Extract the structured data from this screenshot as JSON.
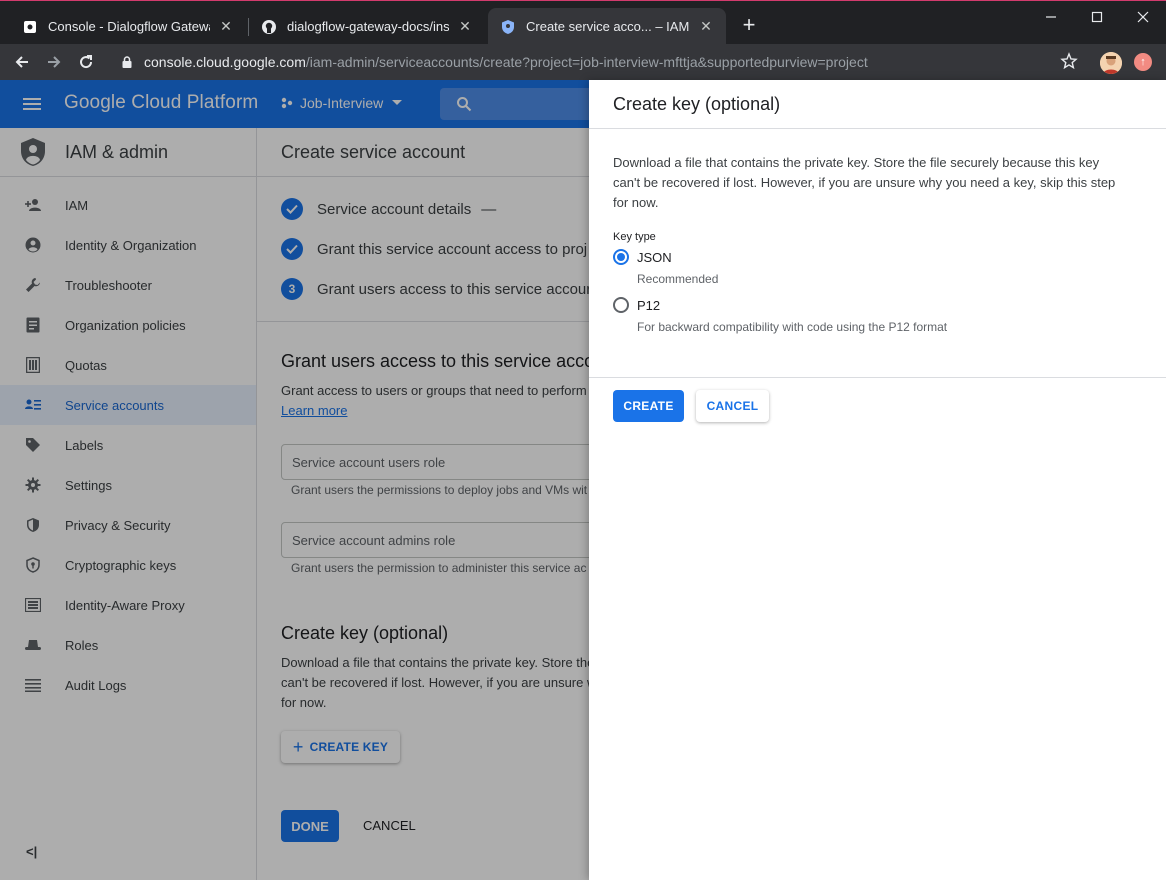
{
  "browser": {
    "tabs": [
      {
        "title": "Console - Dialogflow Gateway",
        "active": false
      },
      {
        "title": "dialogflow-gateway-docs/installa",
        "active": false
      },
      {
        "title": "Create service acco... – IAM & ad",
        "active": true
      }
    ],
    "url_host": "console.cloud.google.com",
    "url_path": "/iam-admin/serviceaccounts/create?project=job-interview-mfttja&supportedpurview=project"
  },
  "header": {
    "brand": "Google Cloud Platform",
    "project": "Job-Interview"
  },
  "sidenav": {
    "title": "IAM & admin",
    "items": [
      {
        "label": "IAM",
        "icon": "person-add-icon"
      },
      {
        "label": "Identity & Organization",
        "icon": "account-circle-icon"
      },
      {
        "label": "Troubleshooter",
        "icon": "wrench-icon"
      },
      {
        "label": "Organization policies",
        "icon": "document-icon"
      },
      {
        "label": "Quotas",
        "icon": "quota-icon"
      },
      {
        "label": "Service accounts",
        "icon": "service-account-icon"
      },
      {
        "label": "Labels",
        "icon": "tag-icon"
      },
      {
        "label": "Settings",
        "icon": "gear-icon"
      },
      {
        "label": "Privacy & Security",
        "icon": "privacy-shield-icon"
      },
      {
        "label": "Cryptographic keys",
        "icon": "crypto-shield-icon"
      },
      {
        "label": "Identity-Aware Proxy",
        "icon": "proxy-icon"
      },
      {
        "label": "Roles",
        "icon": "hat-icon"
      },
      {
        "label": "Audit Logs",
        "icon": "list-icon"
      }
    ],
    "active_index": 5,
    "collapse_label": "<|"
  },
  "main": {
    "title": "Create service account",
    "steps": [
      {
        "label": "Service account details",
        "suffix": "—",
        "done": true
      },
      {
        "label": "Grant this service account access to proj",
        "done": true
      },
      {
        "label": "Grant users access to this service accour",
        "done": false,
        "number": "3"
      }
    ],
    "grant_heading": "Grant users access to this service acco",
    "grant_desc": "Grant access to users or groups that need to perform",
    "learn_more": "Learn more",
    "users_role_placeholder": "Service account users role",
    "users_role_help": "Grant users the permissions to deploy jobs and VMs wit",
    "admins_role_placeholder": "Service account admins role",
    "admins_role_help": "Grant users the permission to administer this service ac",
    "create_key_heading": "Create key (optional)",
    "create_key_desc_1": "Download a file that contains the private key. Store the",
    "create_key_desc_2": "can't be recovered if lost. However, if you are unsure w",
    "create_key_desc_3": "for now.",
    "create_key_button": "CREATE KEY",
    "done_button": "DONE",
    "cancel_button": "CANCEL"
  },
  "panel": {
    "title": "Create key (optional)",
    "description": "Download a file that contains the private key. Store the file securely because this key can't be recovered if lost. However, if you are unsure why you need a key, skip this step for now.",
    "key_type_label": "Key type",
    "options": [
      {
        "label": "JSON",
        "sub": "Recommended",
        "selected": true
      },
      {
        "label": "P12",
        "sub": "For backward compatibility with code using the P12 format",
        "selected": false
      }
    ],
    "create_button": "CREATE",
    "cancel_button": "CANCEL"
  },
  "colors": {
    "accent": "#1a73e8",
    "header_bg": "#1a73e8",
    "chrome_dark": "#202124"
  }
}
